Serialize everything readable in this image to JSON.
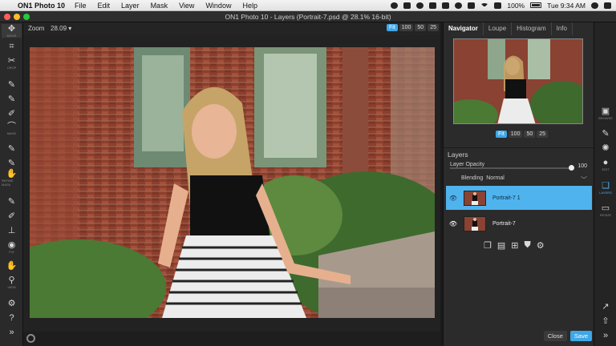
{
  "menubar": {
    "app_name": "ON1 Photo 10",
    "items": [
      "File",
      "Edit",
      "Layer",
      "Mask",
      "View",
      "Window",
      "Help"
    ],
    "battery": "100%",
    "clock": "Tue 9:34 AM"
  },
  "window": {
    "title": "ON1 Photo 10 - Layers (Portrait-7.psd @ 28.1% 16-bit)"
  },
  "canvas_header": {
    "zoom_label": "Zoom",
    "zoom_value": "28.09",
    "zoom_buttons": [
      "Fit",
      "100",
      "50",
      "25"
    ],
    "active_zoom": "Fit"
  },
  "left_tools": [
    {
      "icon": "move-icon",
      "label": "MOVE"
    },
    {
      "icon": "crop-icon",
      "label": "CROP"
    },
    {
      "icon": "mask-icon",
      "label": "MASK"
    },
    {
      "icon": "refine-mask-icon",
      "label": "REFINE MASK"
    },
    {
      "icon": "retouch-icon",
      "label": "FIX"
    },
    {
      "icon": "hand-icon",
      "label": "VIEW"
    }
  ],
  "navigator": {
    "tabs": [
      "Navigator",
      "Loupe",
      "Histogram",
      "Info"
    ],
    "active_tab": "Navigator",
    "zoom_buttons": [
      "Fit",
      "100",
      "50",
      "25"
    ]
  },
  "layers": {
    "title": "Layers",
    "opacity_label": "Layer Opacity",
    "opacity_value": "100",
    "opacity_fraction": 1.0,
    "blending_label": "Blending",
    "blending_value": "Normal",
    "rows": [
      {
        "name": "Portrait-7 1",
        "selected": true
      },
      {
        "name": "Portrait-7",
        "selected": false
      }
    ]
  },
  "footer": {
    "close": "Close",
    "save": "Save"
  },
  "modules": [
    {
      "icon": "browse-icon",
      "label": "BROWSE"
    },
    {
      "icon": "develop-icon",
      "label": ""
    },
    {
      "icon": "effects-icon",
      "label": ""
    },
    {
      "icon": "edit-icon",
      "label": "EDIT"
    },
    {
      "icon": "layers-icon",
      "label": "LAYERS"
    },
    {
      "icon": "resize-icon",
      "label": "RESIZE"
    }
  ],
  "colors": {
    "accent": "#3ea7e8",
    "panel": "#2b2b2b",
    "selected_row": "#4fb3ee"
  }
}
